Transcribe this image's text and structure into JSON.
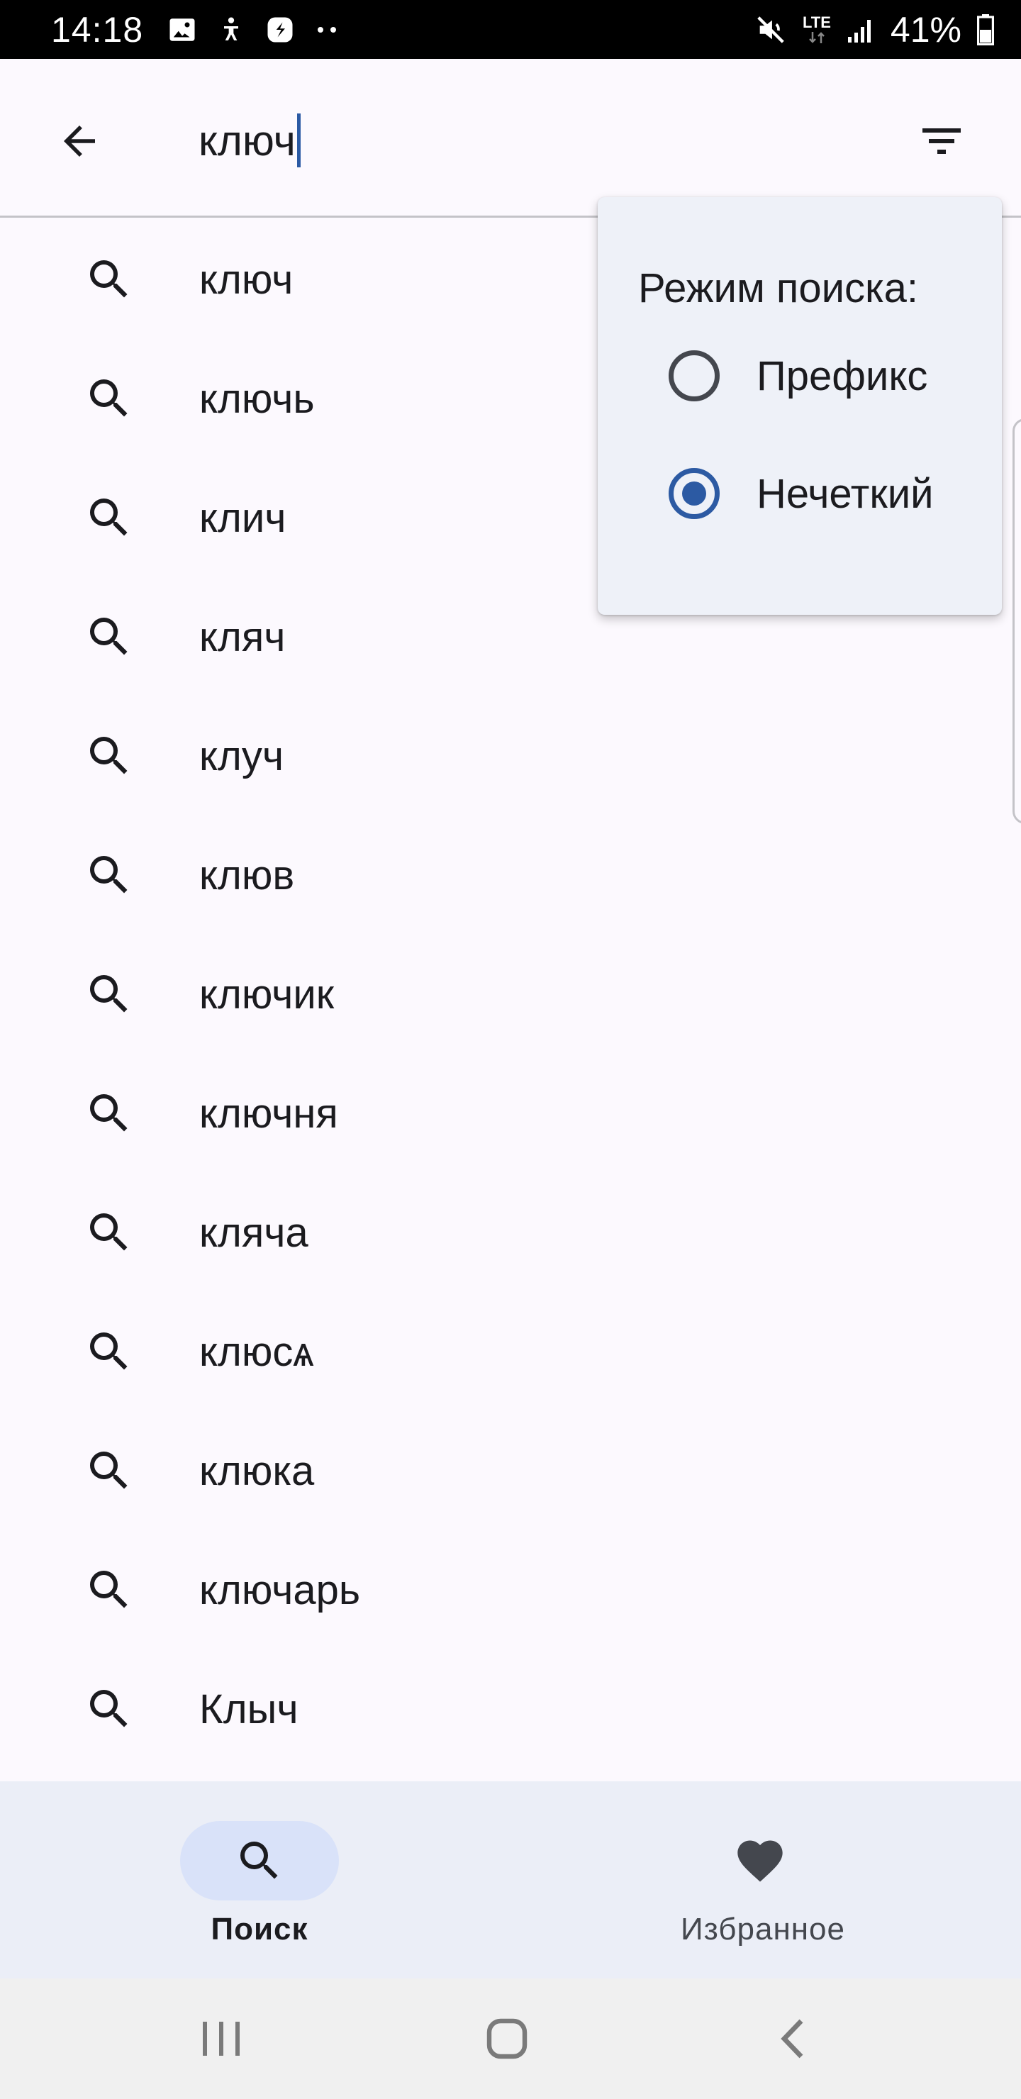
{
  "status_bar": {
    "time": "14:18",
    "network": "LTE",
    "battery": "41%",
    "notification_icons": [
      "gallery-icon",
      "accessibility-icon",
      "app-icon",
      "more-dots-icon"
    ],
    "system_icons": [
      "mute-icon",
      "lte-icon",
      "signal-icon",
      "battery-icon"
    ]
  },
  "search": {
    "value": "ключ"
  },
  "suggestions": [
    "ключ",
    "ключь",
    "клич",
    "кляч",
    "клуч",
    "клюв",
    "ключик",
    "ключня",
    "кляча",
    "клюсѧ",
    "клюка",
    "ключарь",
    "Клыч"
  ],
  "search_mode_menu": {
    "title": "Режим поиска:",
    "options": [
      {
        "label": "Префикс",
        "selected": false
      },
      {
        "label": "Нечеткий",
        "selected": true
      }
    ]
  },
  "bottom_nav": {
    "items": [
      {
        "label": "Поиск",
        "icon": "search-icon",
        "active": true
      },
      {
        "label": "Избранное",
        "icon": "heart-icon",
        "active": false
      }
    ]
  },
  "colors": {
    "accent": "#2c5aa3",
    "background": "#fcf9fe",
    "popup_background": "#eef1f8",
    "nav_background": "#ebeef7",
    "nav_indicator": "#d9e2f9"
  }
}
